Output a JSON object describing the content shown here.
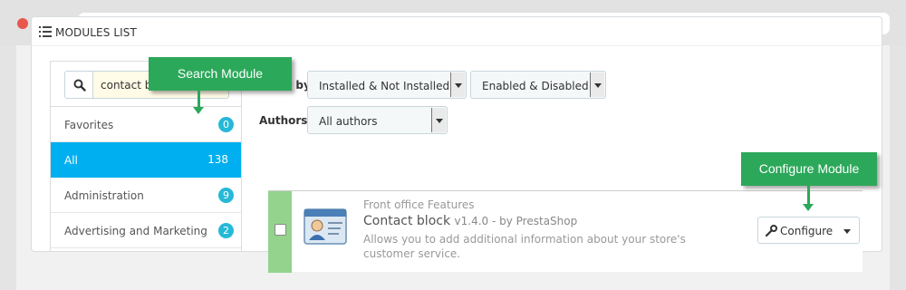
{
  "window": {
    "controls": [
      "close",
      "minimize",
      "maximize"
    ]
  },
  "panel": {
    "title": "MODULES LIST",
    "title_icon": "list-icon"
  },
  "search": {
    "value": "contact block",
    "icon": "search-icon"
  },
  "categories": [
    {
      "label": "Favorites",
      "count": "0",
      "active": false
    },
    {
      "label": "All",
      "count": "138",
      "active": true
    },
    {
      "label": "Administration",
      "count": "9",
      "active": false
    },
    {
      "label": "Advertising and Marketing",
      "count": "2",
      "active": false
    }
  ],
  "filters": {
    "filter_by_label": "Filter by",
    "install_filter": "Installed & Not Installed",
    "enable_filter": "Enabled & Disabled",
    "authors_label": "Authors",
    "authors_filter": "All authors"
  },
  "module": {
    "category": "Front office Features",
    "name": "Contact block",
    "version": "v1.4.0 - by PrestaShop",
    "description": "Allows you to add additional information about your store's customer service.",
    "action_label": "Configure",
    "action_icon": "wrench-icon",
    "status_color": "#93d38e"
  },
  "callouts": {
    "search": "Search Module",
    "configure": "Configure Module"
  },
  "colors": {
    "accent": "#00aff0",
    "badge": "#25b9d7",
    "callout": "#2ca85a"
  }
}
